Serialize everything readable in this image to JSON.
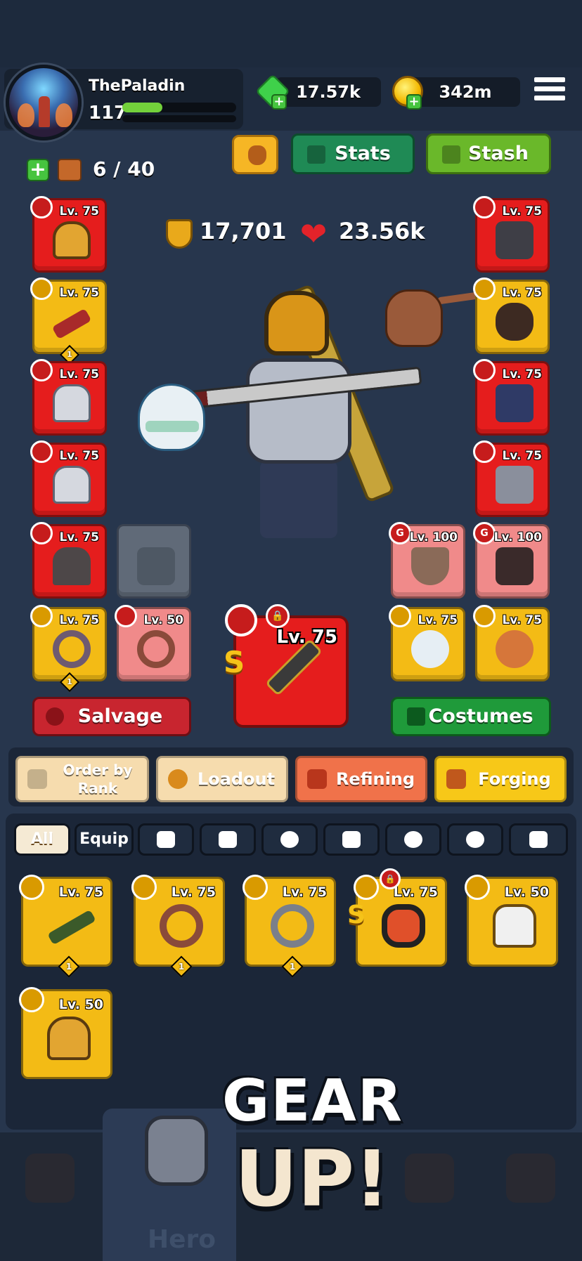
{
  "profile": {
    "name": "ThePaladin",
    "level": "117",
    "xp_progress": 0.35
  },
  "currency": {
    "gems": "17.57k",
    "gold": "342m",
    "gem_icon": "green-gem-icon",
    "coin_icon": "gold-coin-icon"
  },
  "actions": {
    "stats_label": "Stats",
    "stash_label": "Stash"
  },
  "inventory_count": "6 / 40",
  "character": {
    "power": "17,701",
    "health": "23.56k"
  },
  "equipment": {
    "left": [
      {
        "level": "Lv. 75",
        "rarity": "red",
        "item": "helmet"
      },
      {
        "level": "Lv. 75",
        "rarity": "gold",
        "item": "staff",
        "stars": "1"
      },
      {
        "level": "Lv. 75",
        "rarity": "red",
        "item": "shoulders"
      },
      {
        "level": "Lv. 75",
        "rarity": "red",
        "item": "chest"
      },
      {
        "level": "Lv. 75",
        "rarity": "red",
        "item": "cape"
      }
    ],
    "right": [
      {
        "level": "Lv. 75",
        "rarity": "red",
        "item": "gloves"
      },
      {
        "level": "Lv. 75",
        "rarity": "gold",
        "item": "belt"
      },
      {
        "level": "Lv. 75",
        "rarity": "red",
        "item": "legs"
      },
      {
        "level": "Lv. 75",
        "rarity": "red",
        "item": "boots"
      }
    ],
    "guild_items": [
      {
        "level": "Lv. 100",
        "badge": "G"
      },
      {
        "level": "Lv. 100",
        "badge": "G"
      }
    ],
    "pets": [
      {
        "level": "Lv. 75",
        "item": "penguin"
      },
      {
        "level": "Lv. 75",
        "item": "cat"
      }
    ],
    "rings": [
      {
        "level": "Lv. 75",
        "rarity": "gold",
        "stars": "1"
      },
      {
        "level": "Lv. 50",
        "rarity": "pink"
      }
    ],
    "weapon": {
      "level": "Lv. 75",
      "tier": "S"
    }
  },
  "buttons": {
    "salvage": "Salvage",
    "costumes": "Costumes"
  },
  "tabs": {
    "order_by_rank_line1": "Order by",
    "order_by_rank_line2": "Rank",
    "loadout": "Loadout",
    "refining": "Refining",
    "forging": "Forging"
  },
  "filters": {
    "all": "All",
    "equip": "Equip",
    "icons": [
      "sword-icon",
      "armor-icon",
      "ring-icon",
      "guild-icon",
      "paw-icon",
      "swirl-icon",
      "gift-icon"
    ]
  },
  "inventory_items": [
    {
      "level": "Lv. 75",
      "item": "staff",
      "stars": "1"
    },
    {
      "level": "Lv. 75",
      "item": "copper-ring",
      "stars": "1"
    },
    {
      "level": "Lv. 75",
      "item": "skull-ring",
      "stars": "1"
    },
    {
      "level": "Lv. 75",
      "item": "belt",
      "tier": "S"
    },
    {
      "level": "Lv. 50",
      "item": "shoulders"
    },
    {
      "level": "Lv. 50",
      "item": "helmet"
    }
  ],
  "promo": {
    "line1": "GEAR",
    "line2": "UP!"
  },
  "nav": {
    "hero_label": "Hero"
  },
  "colors": {
    "background": "#27364d",
    "rarity_red": "#e51d1d",
    "rarity_gold": "#f3bb15",
    "rarity_pink": "#f08a8a",
    "stats_green": "#1f8a55",
    "stash_green": "#6ab82a",
    "salvage_red": "#c8252f"
  }
}
